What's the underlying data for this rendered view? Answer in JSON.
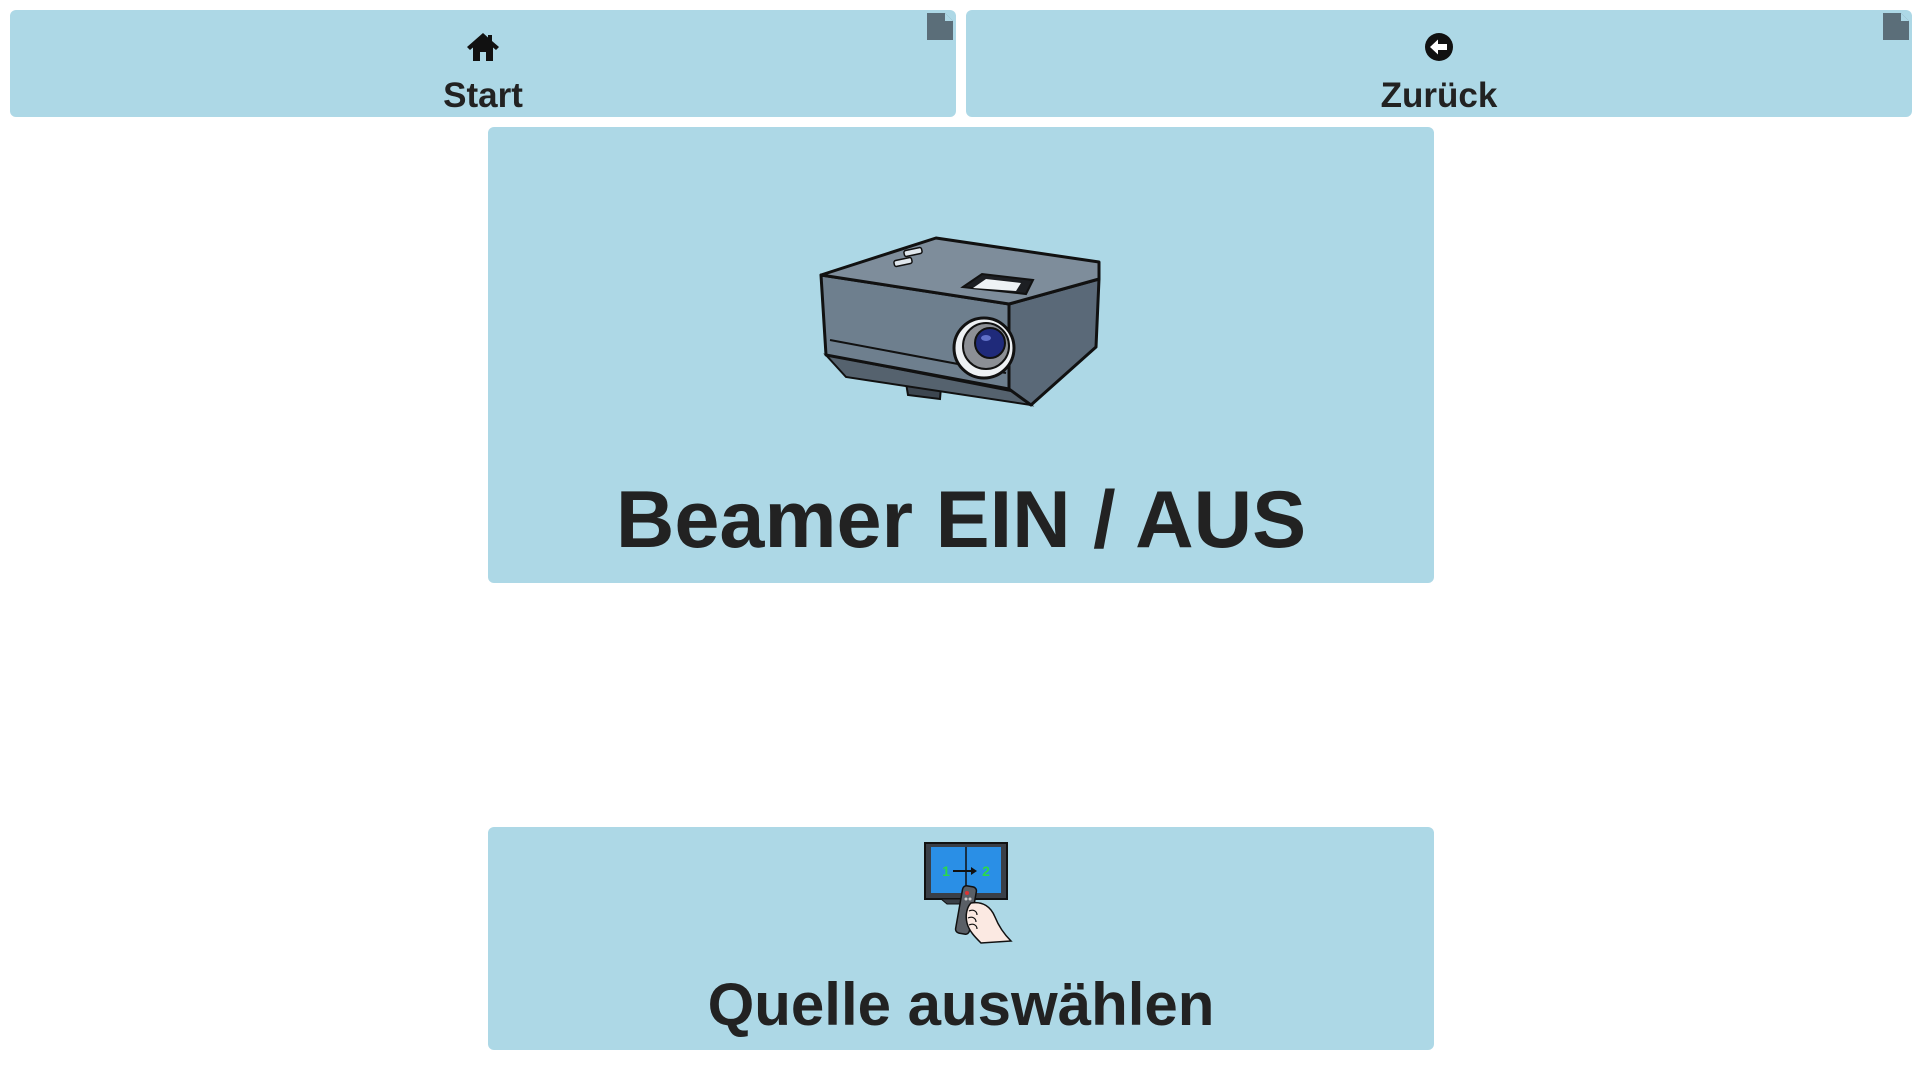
{
  "nav": {
    "start": {
      "label": "Start",
      "icon": "home-icon"
    },
    "back": {
      "label": "Zurück",
      "icon": "arrow-circle-left-icon"
    }
  },
  "tiles": {
    "beamer": {
      "label": "Beamer EIN / AUS",
      "icon": "projector-icon"
    },
    "source": {
      "label": "Quelle auswählen",
      "icon": "screen-remote-icon"
    }
  },
  "colors": {
    "tile_background": "#add8e6",
    "text": "#222222",
    "corner_marker": "#5b6e79"
  }
}
